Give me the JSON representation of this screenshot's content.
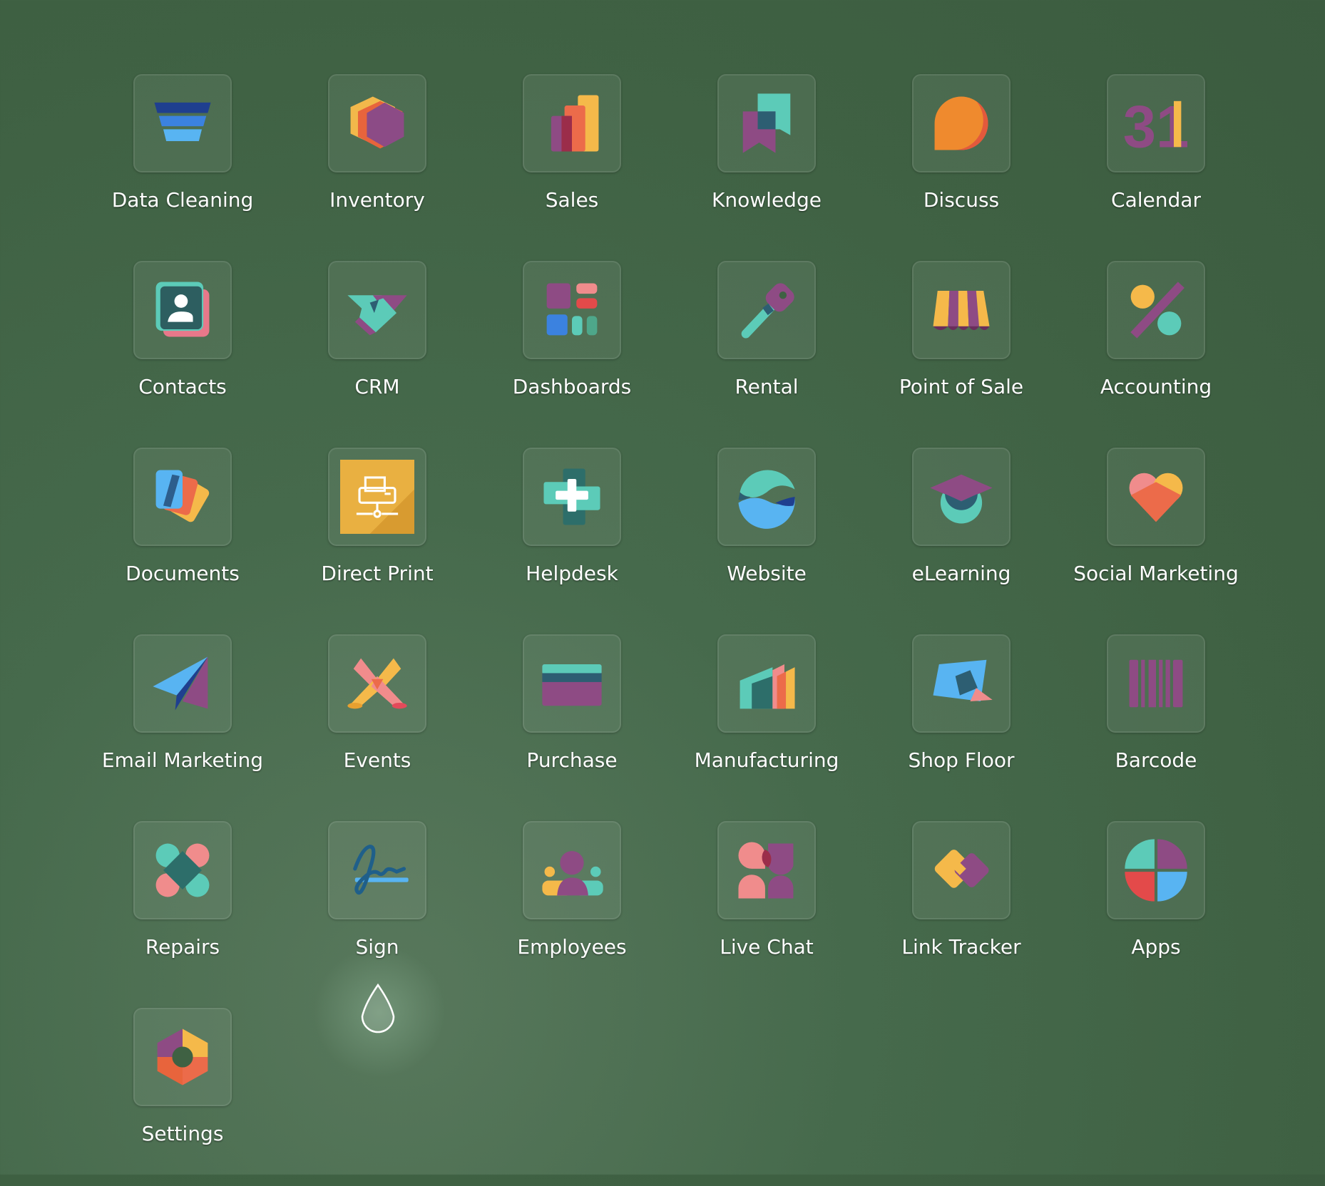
{
  "apps": [
    {
      "label": "Data Cleaning",
      "icon": "data-cleaning-icon"
    },
    {
      "label": "Inventory",
      "icon": "inventory-icon"
    },
    {
      "label": "Sales",
      "icon": "sales-icon"
    },
    {
      "label": "Knowledge",
      "icon": "knowledge-icon"
    },
    {
      "label": "Discuss",
      "icon": "discuss-icon"
    },
    {
      "label": "Calendar",
      "icon": "calendar-icon",
      "icon_text": "31"
    },
    {
      "label": "Contacts",
      "icon": "contacts-icon"
    },
    {
      "label": "CRM",
      "icon": "crm-icon"
    },
    {
      "label": "Dashboards",
      "icon": "dashboards-icon"
    },
    {
      "label": "Rental",
      "icon": "rental-icon"
    },
    {
      "label": "Point of Sale",
      "icon": "point-of-sale-icon"
    },
    {
      "label": "Accounting",
      "icon": "accounting-icon"
    },
    {
      "label": "Documents",
      "icon": "documents-icon"
    },
    {
      "label": "Direct Print",
      "icon": "direct-print-icon"
    },
    {
      "label": "Helpdesk",
      "icon": "helpdesk-icon"
    },
    {
      "label": "Website",
      "icon": "website-icon"
    },
    {
      "label": "eLearning",
      "icon": "elearning-icon"
    },
    {
      "label": "Social Marketing",
      "icon": "social-marketing-icon"
    },
    {
      "label": "Email Marketing",
      "icon": "email-marketing-icon"
    },
    {
      "label": "Events",
      "icon": "events-icon"
    },
    {
      "label": "Purchase",
      "icon": "purchase-icon"
    },
    {
      "label": "Manufacturing",
      "icon": "manufacturing-icon"
    },
    {
      "label": "Shop Floor",
      "icon": "shop-floor-icon"
    },
    {
      "label": "Barcode",
      "icon": "barcode-icon"
    },
    {
      "label": "Repairs",
      "icon": "repairs-icon"
    },
    {
      "label": "Sign",
      "icon": "sign-icon"
    },
    {
      "label": "Employees",
      "icon": "employees-icon"
    },
    {
      "label": "Live Chat",
      "icon": "live-chat-icon"
    },
    {
      "label": "Link Tracker",
      "icon": "link-tracker-icon"
    },
    {
      "label": "Apps",
      "icon": "apps-icon"
    },
    {
      "label": "Settings",
      "icon": "settings-icon"
    }
  ],
  "colors": {
    "background": "#42664a",
    "label": "#ffffff"
  },
  "cursor": {
    "icon": "droplet-cursor-icon"
  }
}
